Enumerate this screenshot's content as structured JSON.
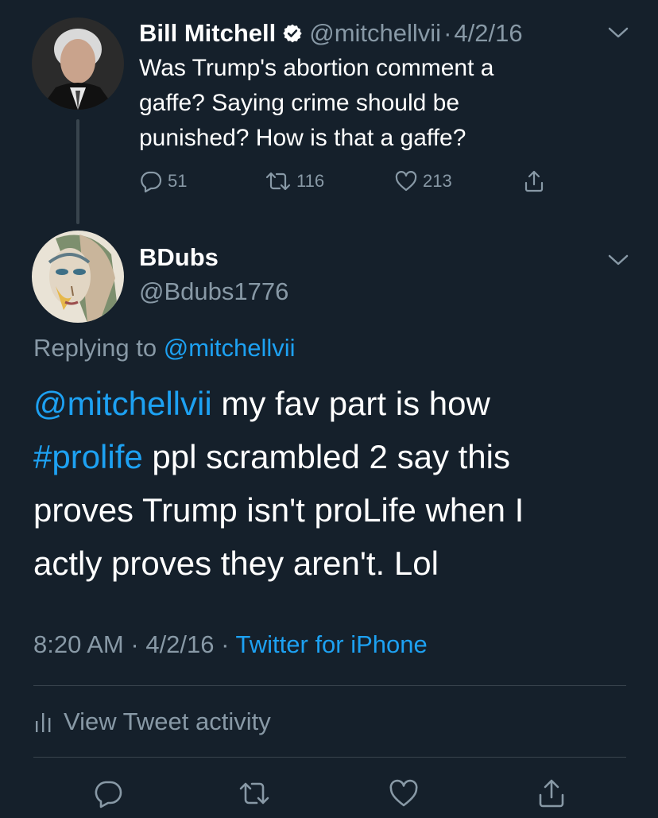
{
  "parent_tweet": {
    "author_name": "Bill Mitchell",
    "verified": true,
    "handle": "@mitchellvii",
    "separator": "·",
    "date": "4/2/16",
    "text_lines": [
      "Was Trump's abortion comment a",
      "gaffe?  Saying crime should be",
      "punished?  How is that a gaffe?"
    ],
    "actions": {
      "reply_count": "51",
      "retweet_count": "116",
      "like_count": "213"
    },
    "icons": [
      "avatar",
      "verified-badge-icon",
      "chevron-down-icon",
      "reply-icon",
      "retweet-icon",
      "like-icon",
      "share-icon"
    ]
  },
  "reply_tweet": {
    "author_name": "BDubs",
    "handle": "@Bdubs1776",
    "replying_prefix": "Replying to",
    "replying_to": "@mitchellvii",
    "text": {
      "mention": "@mitchellvii",
      "line1_rest": " my fav part is how",
      "hashtag": "#prolife",
      "line2_rest": " ppl scrambled 2 say this",
      "line3": "proves Trump isn't proLife when I",
      "line4": "actly proves they aren't. Lol"
    },
    "time": "8:20 AM",
    "date": "4/2/16",
    "separator": "·",
    "source": "Twitter for iPhone",
    "activity_label": "View Tweet activity"
  },
  "colors": {
    "background": "#15202b",
    "text": "#ffffff",
    "muted": "#8899a6",
    "link": "#1da1f2",
    "divider": "#38444d"
  }
}
